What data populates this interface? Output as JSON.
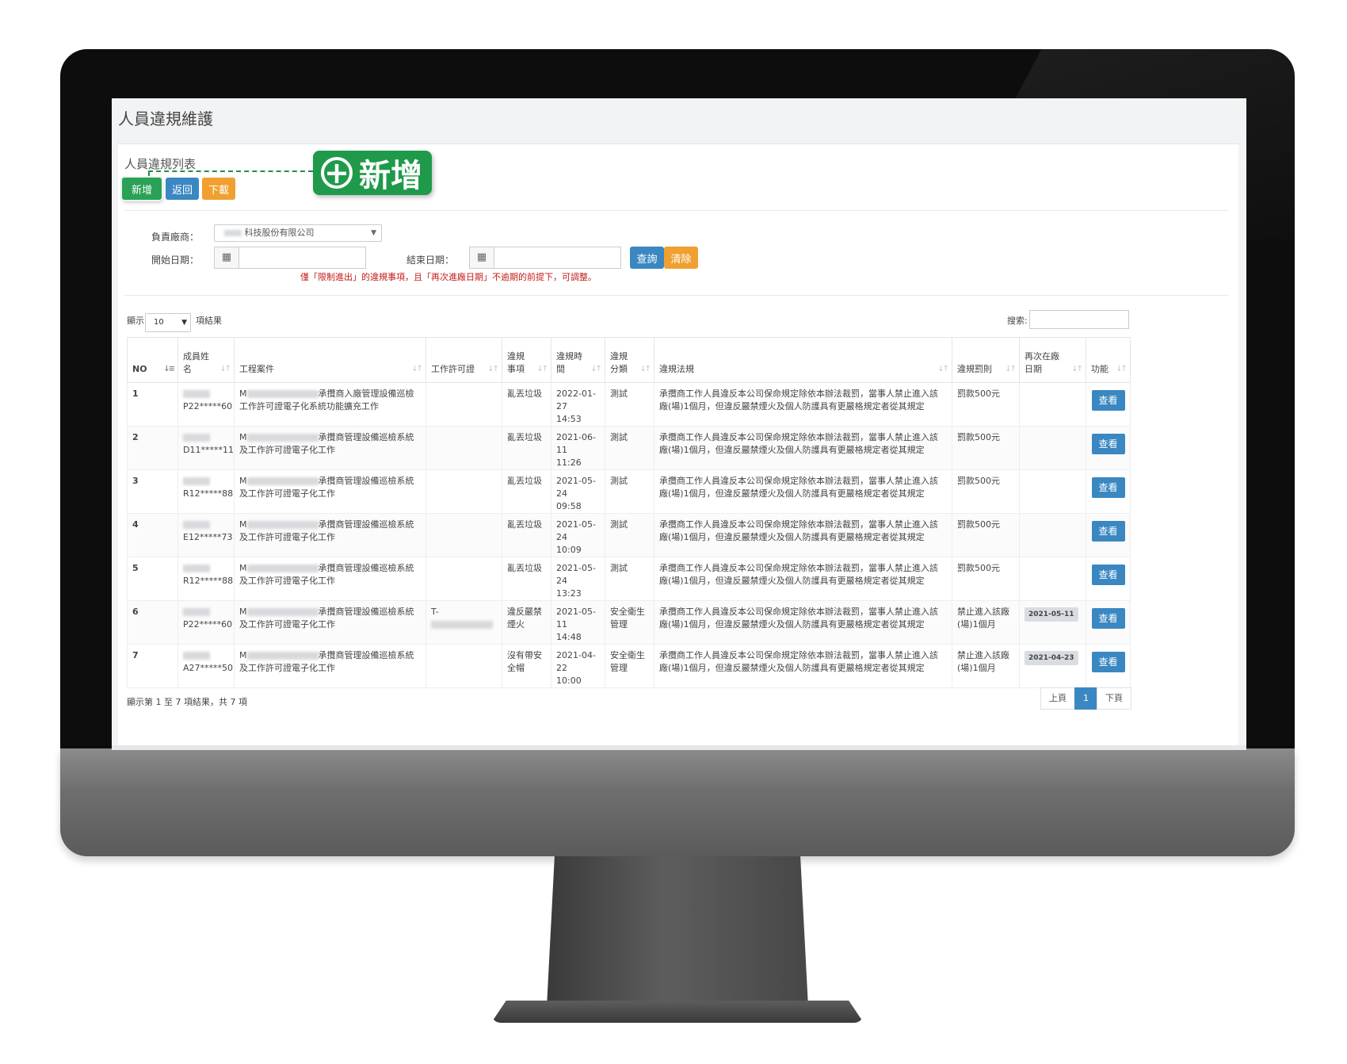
{
  "page": {
    "title": "人員違規維護"
  },
  "panel": {
    "title": "人員違規列表"
  },
  "toolbar": {
    "add": "新增",
    "back": "返回",
    "download": "下載"
  },
  "callout": {
    "label": "新增"
  },
  "filters": {
    "vendor_label": "負責廠商：",
    "vendor_value": "科技股份有限公司",
    "start_label": "開始日期：",
    "end_label": "結束日期：",
    "query": "查詢",
    "clear": "清除",
    "note": "僅「限制進出」的違規事項，且「再次進廠日期」不逾期的前提下，可調整。"
  },
  "table_controls": {
    "show_label": "顯示",
    "page_size": "10",
    "results_label": "項結果",
    "search_label": "搜索:"
  },
  "columns": [
    "NO",
    "成員姓名",
    "工程案件",
    "工作許可證",
    "違規事項",
    "違規時間",
    "違規分類",
    "違規法規",
    "違規罰則",
    "再次在廠日期",
    "功能"
  ],
  "rows": [
    {
      "no": "1",
      "id": "P22*****60",
      "project_a": "承攬商入廠管理設備巡檢",
      "project_b": "工作許可證電子化系統功能擴充工作",
      "permit": "",
      "item": "亂丟垃圾",
      "date": "2022-01-27",
      "time": "14:53",
      "category": "測試",
      "law_a": "承攬商工作人員違反本公司保命規定除依本辦法裁罰，當事人禁止進入該",
      "law_b": "廠(場)1個月，但違反嚴禁煙火及個人防護具有更嚴格規定者從其規定",
      "penalty": "罰款500元",
      "reentry": "",
      "action": "查看"
    },
    {
      "no": "2",
      "id": "D11*****11",
      "project_a": "承攬商管理設備巡檢系統",
      "project_b": "及工作許可證電子化工作",
      "permit": "",
      "item": "亂丟垃圾",
      "date": "2021-06-11",
      "time": "11:26",
      "category": "測試",
      "law_a": "承攬商工作人員違反本公司保命規定除依本辦法裁罰，當事人禁止進入該",
      "law_b": "廠(場)1個月，但違反嚴禁煙火及個人防護具有更嚴格規定者從其規定",
      "penalty": "罰款500元",
      "reentry": "",
      "action": "查看"
    },
    {
      "no": "3",
      "id": "R12*****88",
      "project_a": "承攬商管理設備巡檢系統",
      "project_b": "及工作許可證電子化工作",
      "permit": "",
      "item": "亂丟垃圾",
      "date": "2021-05-24",
      "time": "09:58",
      "category": "測試",
      "law_a": "承攬商工作人員違反本公司保命規定除依本辦法裁罰，當事人禁止進入該",
      "law_b": "廠(場)1個月，但違反嚴禁煙火及個人防護具有更嚴格規定者從其規定",
      "penalty": "罰款500元",
      "reentry": "",
      "action": "查看"
    },
    {
      "no": "4",
      "id": "E12*****73",
      "project_a": "承攬商管理設備巡檢系統",
      "project_b": "及工作許可證電子化工作",
      "permit": "",
      "item": "亂丟垃圾",
      "date": "2021-05-24",
      "time": "10:09",
      "category": "測試",
      "law_a": "承攬商工作人員違反本公司保命規定除依本辦法裁罰，當事人禁止進入該",
      "law_b": "廠(場)1個月，但違反嚴禁煙火及個人防護具有更嚴格規定者從其規定",
      "penalty": "罰款500元",
      "reentry": "",
      "action": "查看"
    },
    {
      "no": "5",
      "id": "R12*****88",
      "project_a": "承攬商管理設備巡檢系統",
      "project_b": "及工作許可證電子化工作",
      "permit": "",
      "item": "亂丟垃圾",
      "date": "2021-05-24",
      "time": "13:23",
      "category": "測試",
      "law_a": "承攬商工作人員違反本公司保命規定除依本辦法裁罰，當事人禁止進入該",
      "law_b": "廠(場)1個月，但違反嚴禁煙火及個人防護具有更嚴格規定者從其規定",
      "penalty": "罰款500元",
      "reentry": "",
      "action": "查看"
    },
    {
      "no": "6",
      "id": "P22*****60",
      "project_a": "承攬商管理設備巡檢系統",
      "project_b": "及工作許可證電子化工作",
      "permit": "T-",
      "item": "違反嚴禁煙火",
      "date": "2021-05-11",
      "time": "14:48",
      "category": "安全衛生管理",
      "law_a": "承攬商工作人員違反本公司保命規定除依本辦法裁罰，當事人禁止進入該",
      "law_b": "廠(場)1個月，但違反嚴禁煙火及個人防護具有更嚴格規定者從其規定",
      "penalty": "禁止進入該廠(場)1個月",
      "reentry": "2021-05-11",
      "action": "查看"
    },
    {
      "no": "7",
      "id": "A27*****50",
      "project_a": "承攬商管理設備巡檢系統",
      "project_b": "及工作許可證電子化工作",
      "permit": "",
      "item": "沒有帶安全帽",
      "date": "2021-04-22",
      "time": "10:00",
      "category": "安全衛生管理",
      "law_a": "承攬商工作人員違反本公司保命規定除依本辦法裁罰，當事人禁止進入該",
      "law_b": "廠(場)1個月，但違反嚴禁煙火及個人防護具有更嚴格規定者從其規定",
      "penalty": "禁止進入該廠(場)1個月",
      "reentry": "2021-04-23",
      "action": "查看"
    }
  ],
  "footer": {
    "info": "顯示第 1 至 7 項結果，共 7 項",
    "prev": "上頁",
    "page": "1",
    "next": "下頁"
  }
}
